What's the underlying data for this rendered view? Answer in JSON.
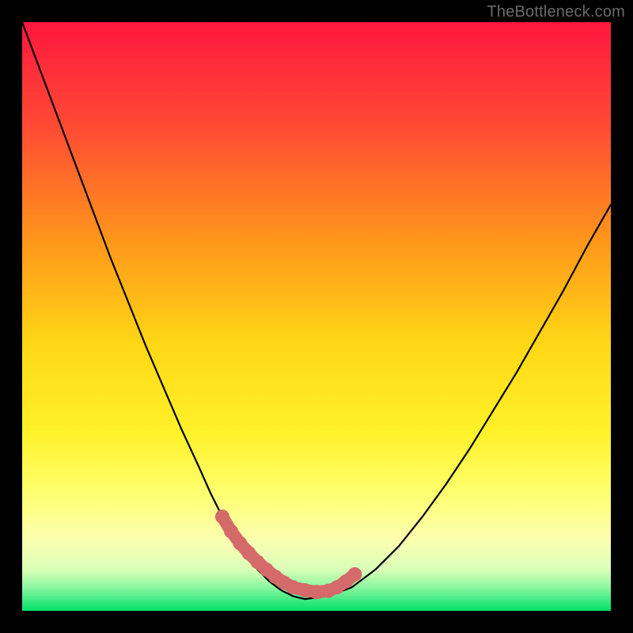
{
  "watermark": "TheBottleneck.com",
  "colors": {
    "frame": "#000000",
    "gradient_top": "#ff173f",
    "gradient_mid_upper": "#ff8a1f",
    "gradient_mid": "#ffe617",
    "gradient_mid_lower": "#fffb70",
    "gradient_lower": "#f8ffab",
    "gradient_bottom": "#00e06a",
    "curve": "#000000",
    "marker_fill": "#d46a6a",
    "marker_stroke": "#b74f4f"
  },
  "chart_data": {
    "type": "line",
    "title": "",
    "xlabel": "",
    "ylabel": "",
    "xlim": [
      0,
      100
    ],
    "ylim": [
      0,
      100
    ],
    "series": [
      {
        "name": "bottleneck-curve",
        "x": [
          0,
          3,
          6,
          9,
          12,
          15,
          18,
          21,
          24,
          27,
          30,
          32,
          34,
          36,
          38,
          40,
          42,
          44,
          46,
          48,
          52,
          56,
          60,
          64,
          68,
          72,
          76,
          80,
          84,
          88,
          92,
          96,
          100
        ],
        "y": [
          100,
          92,
          84,
          76,
          68,
          60,
          52.5,
          45,
          38,
          31,
          24.5,
          20,
          16,
          12.5,
          9.5,
          7,
          5,
          3.5,
          2.5,
          2,
          2.5,
          4,
          7,
          11,
          16,
          21.5,
          27.5,
          34,
          40.5,
          47.5,
          54.5,
          62,
          69
        ]
      },
      {
        "name": "optimal-zone-markers",
        "x": [
          34,
          35.5,
          37,
          38.5,
          40,
          41.5,
          43,
          44.5,
          46,
          48,
          50,
          52,
          53.5,
          55,
          56.5
        ],
        "y": [
          16,
          13.5,
          11.5,
          9.8,
          8.3,
          7,
          5.8,
          4.8,
          4,
          3.5,
          3.2,
          3.4,
          4,
          5,
          6.2
        ]
      }
    ]
  }
}
